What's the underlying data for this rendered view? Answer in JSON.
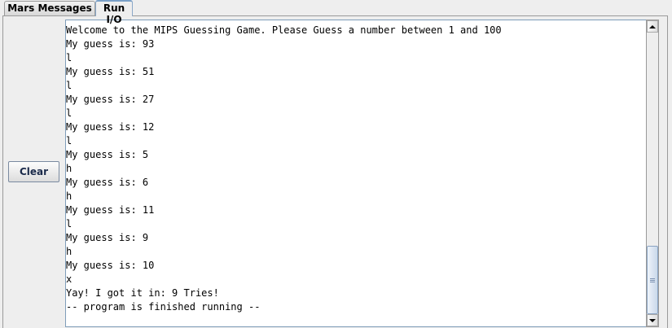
{
  "tabs": [
    {
      "label": "Mars Messages",
      "active": false
    },
    {
      "label": "Run I/O",
      "active": true
    }
  ],
  "clear_button": {
    "label": "Clear"
  },
  "output_lines": [
    "Welcome to the MIPS Guessing Game. Please Guess a number between 1 and 100",
    "My guess is: 93",
    "l",
    "My guess is: 51",
    "l",
    "My guess is: 27",
    "l",
    "My guess is: 12",
    "l",
    "My guess is: 5",
    "h",
    "My guess is: 6",
    "h",
    "My guess is: 11",
    "l",
    "My guess is: 9",
    "h",
    "My guess is: 10",
    "x",
    "Yay! I got it in: 9 Tries!",
    "-- program is finished running --"
  ],
  "icons": {
    "scroll_up": "arrow-up-icon",
    "scroll_down": "arrow-down-icon",
    "thumb_grip": "grip-icon"
  },
  "colors": {
    "panel_bg": "#eeeeee",
    "output_bg": "#ffffff",
    "output_border": "#7f9db9",
    "thumb": "#c9d8ea"
  }
}
